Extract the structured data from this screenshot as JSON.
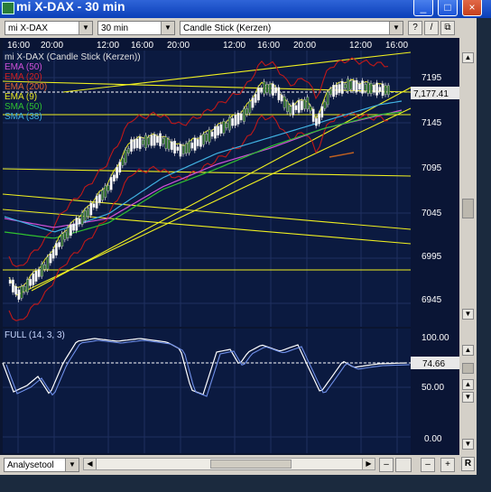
{
  "window": {
    "title": "mi X-DAX - 30 min",
    "minimize": "_",
    "maximize": "□",
    "close": "×"
  },
  "toolbar": {
    "instrument": "mi X-DAX",
    "interval": "30 min",
    "chart_type": "Candle Stick (Kerzen)",
    "buttons": [
      "?",
      "/",
      "⧉"
    ]
  },
  "chart": {
    "time_labels": [
      "16:00",
      "20:00",
      "12:00",
      "16:00",
      "20:00",
      "12:00",
      "16:00",
      "20:00",
      "12:00",
      "16:00"
    ],
    "header": "mi X-DAX (Candle Stick (Kerzen))",
    "indicators": [
      {
        "label": "EMA (50)",
        "color": "#d050d8"
      },
      {
        "label": "EMA (20)",
        "color": "#d02020"
      },
      {
        "label": "EMA (200)",
        "color": "#e06030"
      },
      {
        "label": "EMA (9)",
        "color": "#e8e820"
      },
      {
        "label": "SMA (50)",
        "color": "#30c030"
      },
      {
        "label": "SMA (38)",
        "color": "#40b0e0"
      }
    ],
    "price_ticks": [
      "7195",
      "7145",
      "7095",
      "7045",
      "6995",
      "6945"
    ],
    "current_price": "7,177.41"
  },
  "oscillator": {
    "label": "FULL (14, 3, 3)",
    "ticks": [
      "100.00",
      "50.00",
      "0.00"
    ],
    "current_value": "74.66"
  },
  "bottom": {
    "tool_select": "Analysetool",
    "right_button": "R"
  }
}
